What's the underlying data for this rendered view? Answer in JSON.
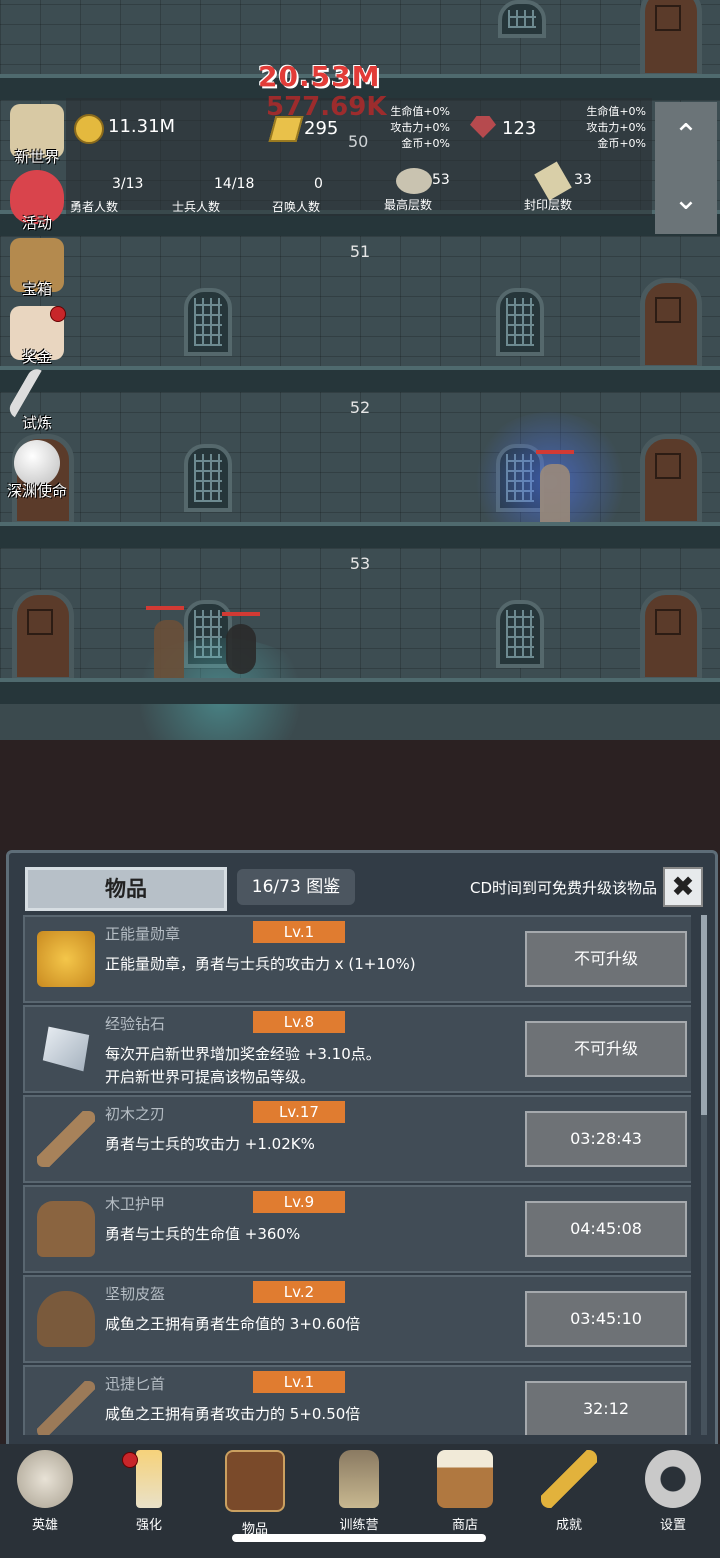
{
  "hud": {
    "coins": "11.31M",
    "gold": "295",
    "gems": "123",
    "floor_top": "50",
    "buffs_left": [
      "生命值+0%",
      "攻击力+0%",
      "金币+0%"
    ],
    "buffs_right": [
      "生命值+0%",
      "攻击力+0%",
      "金币+0%"
    ],
    "heroes": {
      "value": "3/13",
      "label": "勇者人数"
    },
    "soldiers": {
      "value": "14/18",
      "label": "士兵人数"
    },
    "summons": {
      "value": "0",
      "label": "召唤人数"
    },
    "max_floor": {
      "value": "53",
      "label": "最高层数"
    },
    "sealed_floor": {
      "value": "33",
      "label": "封印层数"
    },
    "damage_main": "20.53M",
    "damage_sub": "577.69K",
    "scroll_up": "⌃",
    "scroll_down": "⌄"
  },
  "floors": [
    "51",
    "52",
    "53"
  ],
  "left_menu": [
    {
      "label": "新世界",
      "icon": "map-scroll-icon"
    },
    {
      "label": "活动",
      "icon": "heart-icon"
    },
    {
      "label": "宝箱",
      "icon": "treasure-chest-icon"
    },
    {
      "label": "奖金",
      "icon": "letter-icon"
    },
    {
      "label": "试炼",
      "icon": "quill-icon"
    },
    {
      "label": "深渊使命",
      "icon": "pearl-icon"
    }
  ],
  "panel": {
    "tab_label": "物品",
    "collection": "16/73 图鉴",
    "cd_hint": "CD时间到可免费升级该物品",
    "close_label": "✖"
  },
  "items": [
    {
      "name": "正能量勋章",
      "level": "Lv.1",
      "desc": [
        "正能量勋章，勇者与士兵的攻击力 x (1+10%)"
      ],
      "button": "不可升级",
      "icon": "crown-icon"
    },
    {
      "name": "经验钻石",
      "level": "Lv.8",
      "desc": [
        "每次开启新世界增加奖金经验 +3.10点。",
        "开启新世界可提高该物品等级。"
      ],
      "button": "不可升级",
      "icon": "diamond-icon"
    },
    {
      "name": "初木之刃",
      "level": "Lv.17",
      "desc": [
        "勇者与士兵的攻击力 +1.02K%"
      ],
      "button": "03:28:43",
      "icon": "wooden-sword-icon"
    },
    {
      "name": "木卫护甲",
      "level": "Lv.9",
      "desc": [
        "勇者与士兵的生命值 +360%"
      ],
      "button": "04:45:08",
      "icon": "armor-icon"
    },
    {
      "name": "坚韧皮盔",
      "level": "Lv.2",
      "desc": [
        "咸鱼之王拥有勇者生命值的 3+0.60倍"
      ],
      "button": "03:45:10",
      "icon": "leather-helmet-icon"
    },
    {
      "name": "迅捷匕首",
      "level": "Lv.1",
      "desc": [
        "咸鱼之王拥有勇者攻击力的 5+0.50倍"
      ],
      "button": "32:12",
      "icon": "dagger-icon"
    }
  ],
  "nav": [
    {
      "label": "英雄",
      "icon": "skull-icon"
    },
    {
      "label": "强化",
      "icon": "candle-icon"
    },
    {
      "label": "物品",
      "icon": "book-icon"
    },
    {
      "label": "训练营",
      "icon": "lantern-icon"
    },
    {
      "label": "商店",
      "icon": "beer-mug-icon"
    },
    {
      "label": "成就",
      "icon": "key-icon"
    },
    {
      "label": "设置",
      "icon": "gear-icon"
    }
  ],
  "colors": {
    "level_badge": "#e07c30",
    "panel_bg": "#323c46",
    "damage": "#e23c38"
  }
}
